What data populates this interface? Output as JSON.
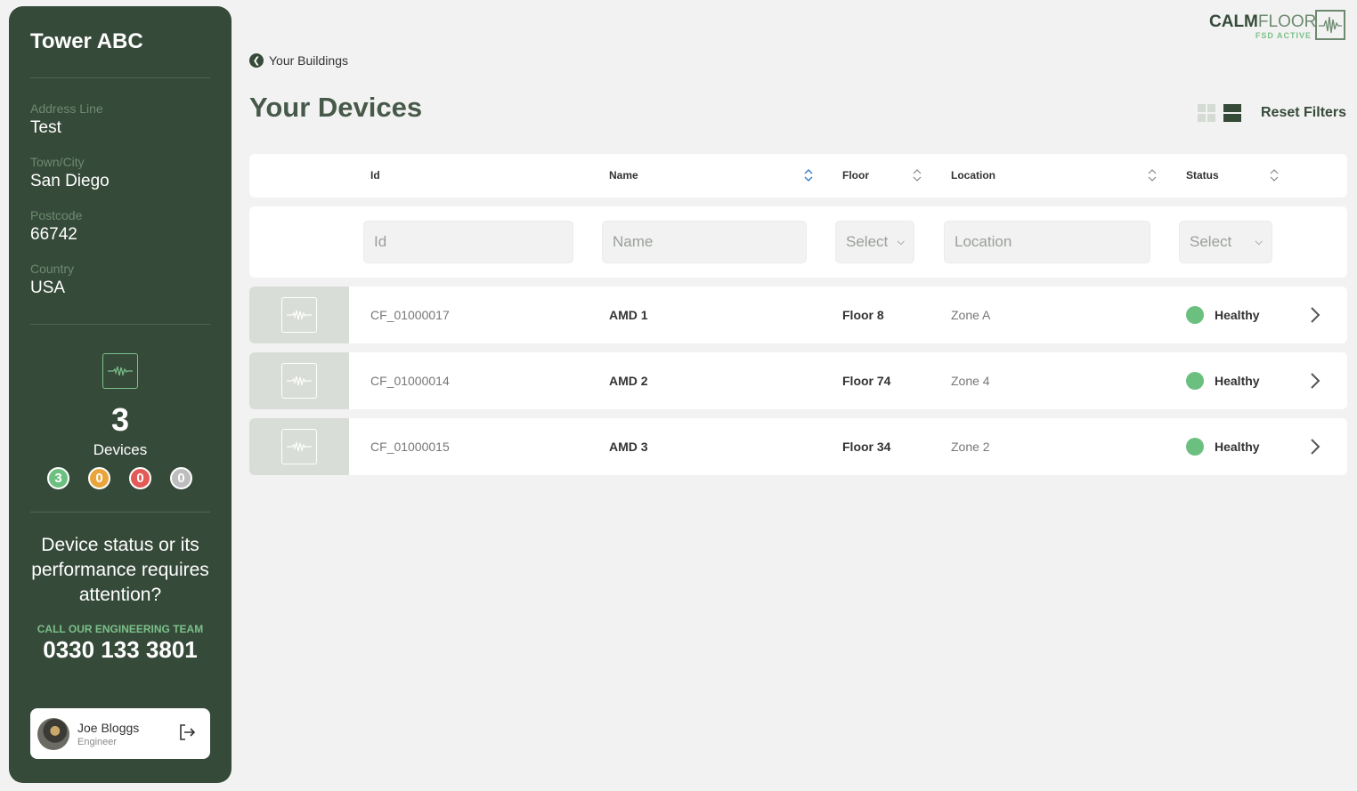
{
  "building": {
    "name": "Tower ABC",
    "fields": [
      {
        "label": "Address Line",
        "value": "Test"
      },
      {
        "label": "Town/City",
        "value": "San Diego"
      },
      {
        "label": "Postcode",
        "value": "66742"
      },
      {
        "label": "Country",
        "value": "USA"
      }
    ]
  },
  "summary": {
    "device_count": "3",
    "device_label": "Devices",
    "badges": [
      {
        "value": "0",
        "color": "#6cc07f"
      },
      {
        "value": "0",
        "color": "#e9a53c"
      },
      {
        "value": "0",
        "color": "#e45a57"
      },
      {
        "value": "0",
        "color": "#bdbdbd"
      }
    ],
    "badge_first": "3"
  },
  "support": {
    "message": "Device status or its performance requires attention?",
    "call_label": "CALL OUR ENGINEERING TEAM",
    "phone": "0330 133 3801"
  },
  "user": {
    "name": "Joe Bloggs",
    "role": "Engineer"
  },
  "logo": {
    "calm": "CALM",
    "floor": "FLOOR",
    "sub": "FSD ACTIVE"
  },
  "nav": {
    "back_label": "Your Buildings"
  },
  "page": {
    "title": "Your Devices",
    "reset_filters": "Reset Filters"
  },
  "table": {
    "headers": {
      "id": "Id",
      "name": "Name",
      "floor": "Floor",
      "location": "Location",
      "status": "Status"
    },
    "filters": {
      "id_placeholder": "Id",
      "name_placeholder": "Name",
      "floor_select": "Select",
      "location_placeholder": "Location",
      "status_select": "Select"
    },
    "rows": [
      {
        "id": "CF_01000017",
        "name": "AMD 1",
        "floor": "Floor 8",
        "location": "Zone A",
        "status": "Healthy"
      },
      {
        "id": "CF_01000014",
        "name": "AMD 2",
        "floor": "Floor 74",
        "location": "Zone 4",
        "status": "Healthy"
      },
      {
        "id": "CF_01000015",
        "name": "AMD 3",
        "floor": "Floor 34",
        "location": "Zone 2",
        "status": "Healthy"
      }
    ]
  },
  "colors": {
    "brand_dark": "#364a39",
    "brand_accent": "#7bc08a",
    "healthy": "#6cc07f"
  }
}
